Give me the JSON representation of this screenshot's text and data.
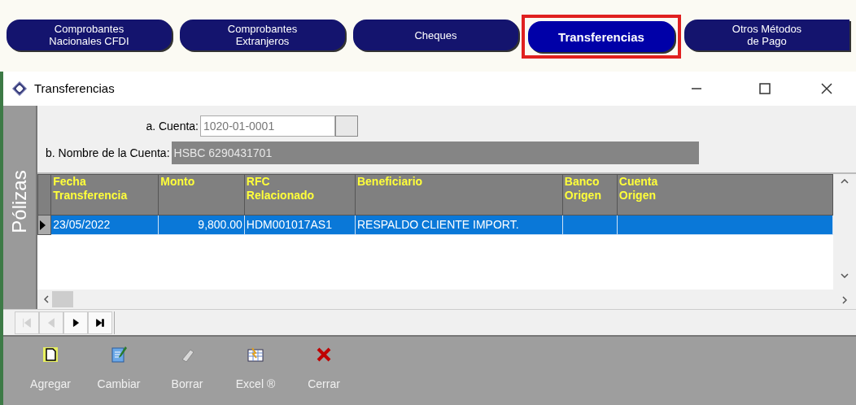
{
  "tabs": [
    {
      "label": "Comprobantes\nNacionales CFDI",
      "selected": false
    },
    {
      "label": "Comprobantes\nExtranjeros",
      "selected": false
    },
    {
      "label": "Cheques",
      "selected": false
    },
    {
      "label": "Transferencias",
      "selected": true
    },
    {
      "label": "Otros Métodos\nde Pago",
      "selected": false
    }
  ],
  "window": {
    "title": "Transferencias"
  },
  "side_tab": "Pólizas",
  "form": {
    "cuenta_label": "a. Cuenta:",
    "cuenta_value": "1020-01-0001",
    "nombre_label": "b. Nombre de la Cuenta:",
    "nombre_value": "HSBC 6290431701"
  },
  "table": {
    "columns": [
      "Fecha\nTransferencia",
      "Monto",
      "RFC\nRelacionado",
      "Beneficiario",
      "Banco\nOrigen",
      "Cuenta\nOrigen"
    ],
    "rows": [
      {
        "selected": true,
        "cells": [
          "23/05/2022",
          "9,800.00",
          "HDM001017AS1",
          "RESPALDO CLIENTE IMPORT.",
          "",
          ""
        ]
      }
    ]
  },
  "navigator": [
    {
      "kind": "first",
      "disabled": true
    },
    {
      "kind": "prev",
      "disabled": true
    },
    {
      "kind": "next",
      "disabled": false
    },
    {
      "kind": "last",
      "disabled": false
    }
  ],
  "toolbar": [
    {
      "kind": "add",
      "label": "Agregar"
    },
    {
      "kind": "edit",
      "label": "Cambiar"
    },
    {
      "kind": "erase",
      "label": "Borrar"
    },
    {
      "kind": "excel",
      "label": "Excel ®"
    },
    {
      "kind": "close",
      "label": "Cerrar"
    }
  ]
}
